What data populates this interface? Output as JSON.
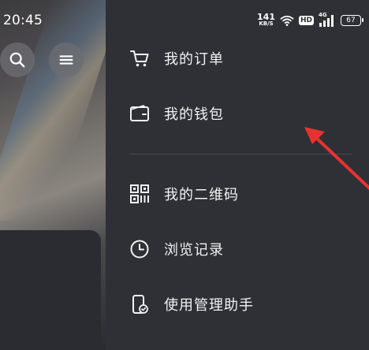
{
  "status_bar": {
    "time": "20:45",
    "net_speed_value": "141",
    "net_speed_unit": "KB/S",
    "hd_badge": "HD",
    "network_type": "4G",
    "battery_level": "67"
  },
  "drawer": {
    "items": [
      {
        "label": "我的订单",
        "icon": "shopping-cart-icon"
      },
      {
        "label": "我的钱包",
        "icon": "wallet-icon"
      },
      {
        "label": "我的二维码",
        "icon": "qr-code-icon"
      },
      {
        "label": "浏览记录",
        "icon": "clock-icon"
      },
      {
        "label": "使用管理助手",
        "icon": "phone-check-icon"
      }
    ]
  },
  "background_page": {
    "buttons": [
      "search-icon",
      "menu-icon"
    ]
  },
  "annotation": {
    "arrow_color": "#e8322f",
    "points_to": "我的钱包"
  }
}
